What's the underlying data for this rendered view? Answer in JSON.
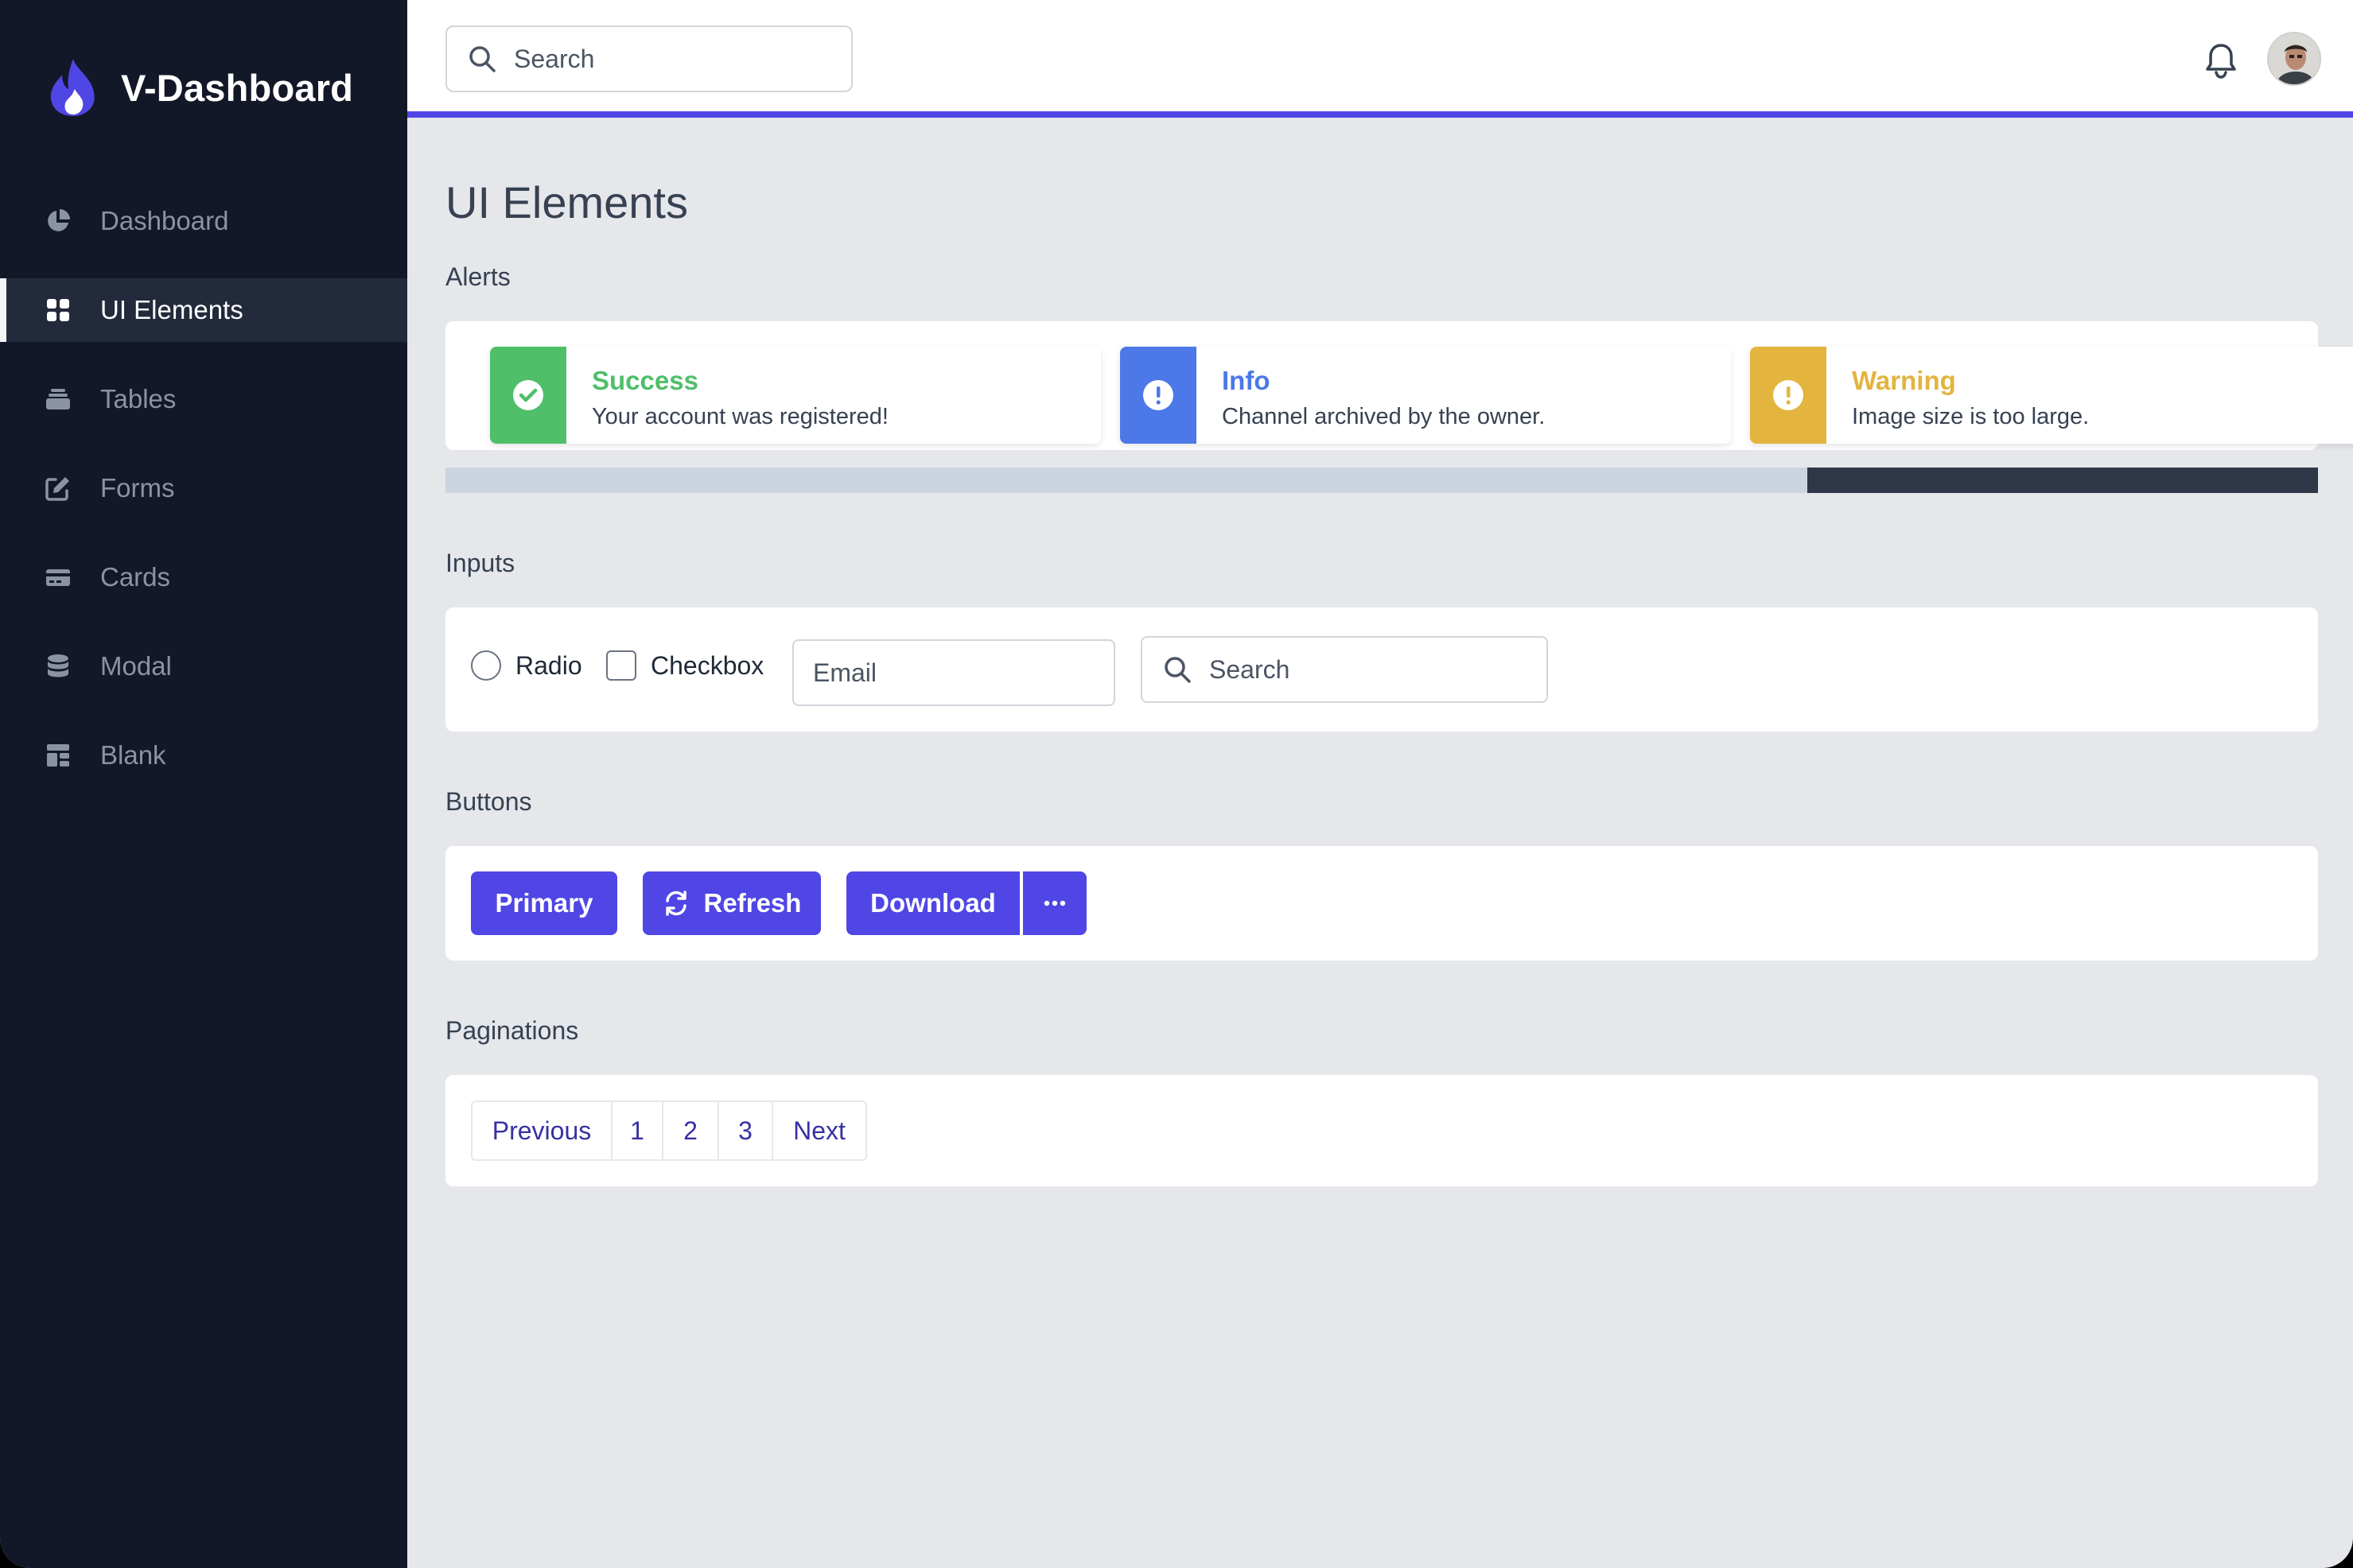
{
  "app": {
    "name": "V-Dashboard",
    "accent": "#4f46e5",
    "sidebar_bg": "#121827"
  },
  "sidebar": {
    "items": [
      {
        "label": "Dashboard",
        "icon": "chart-pie-icon",
        "active": false
      },
      {
        "label": "UI Elements",
        "icon": "grid-icon",
        "active": true
      },
      {
        "label": "Tables",
        "icon": "inbox-stack-icon",
        "active": false
      },
      {
        "label": "Forms",
        "icon": "edit-icon",
        "active": false
      },
      {
        "label": "Cards",
        "icon": "credit-card-icon",
        "active": false
      },
      {
        "label": "Modal",
        "icon": "database-icon",
        "active": false
      },
      {
        "label": "Blank",
        "icon": "template-icon",
        "active": false
      }
    ]
  },
  "header": {
    "search_placeholder": "Search",
    "icons": [
      "search-icon",
      "bell-icon",
      "avatar"
    ]
  },
  "main": {
    "title": "UI Elements",
    "sections": {
      "alerts": "Alerts",
      "inputs": "Inputs",
      "buttons": "Buttons",
      "paginations": "Paginations"
    },
    "alerts": [
      {
        "title": "Success",
        "text": "Your account was registered!",
        "color": "#4fbf6a",
        "icon": "check-circle-icon"
      },
      {
        "title": "Info",
        "text": "Channel archived by the owner.",
        "color": "#4c78e8",
        "icon": "exclamation-circle-icon"
      },
      {
        "title": "Warning",
        "text": "Image size is too large.",
        "color": "#e3b43e",
        "icon": "exclamation-circle-icon"
      }
    ],
    "inputs": {
      "radio_label": "Radio",
      "checkbox_label": "Checkbox",
      "email_placeholder": "Email",
      "search_placeholder": "Search"
    },
    "buttons": {
      "primary": "Primary",
      "refresh": "Refresh",
      "download": "Download",
      "more_icon": "ellipsis-icon"
    },
    "pagination": {
      "previous": "Previous",
      "pages": [
        "1",
        "2",
        "3"
      ],
      "next": "Next"
    }
  }
}
